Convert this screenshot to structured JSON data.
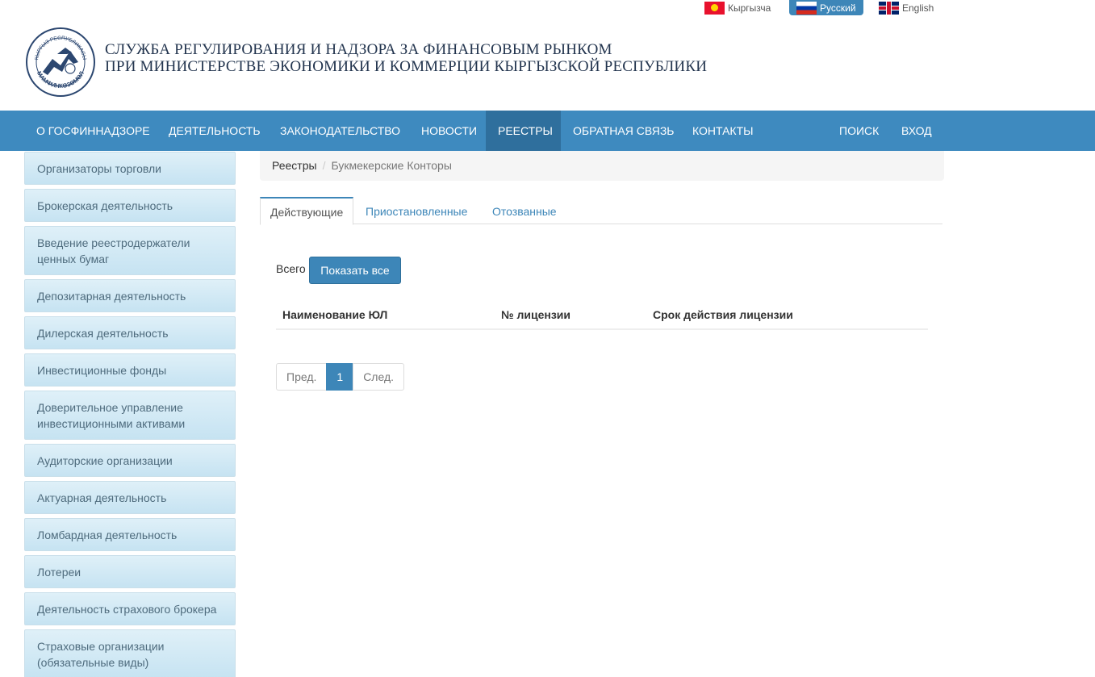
{
  "languages": [
    {
      "label": "Кыргызча"
    },
    {
      "label": "Русский"
    },
    {
      "label": "English"
    }
  ],
  "header": {
    "line1": "СЛУЖБА РЕГУЛИРОВАНИЯ И НАДЗОРА ЗА ФИНАНСОВЫМ РЫНКОМ",
    "line2": "ПРИ МИНИСТЕРСТВЕ ЭКОНОМИКИ И КОММЕРЦИИ КЫРГЫЗСКОЙ РЕСПУБЛИКИ",
    "logo_text_top": "КЫРГЫЗ РЕСПУБЛИКАСЫ",
    "logo_text_bottom": "МАМФИНКӨЗӨМӨЛ"
  },
  "nav": [
    {
      "label": "О ГОСФИННАДЗОРЕ"
    },
    {
      "label": "ДЕЯТЕЛЬНОСТЬ"
    },
    {
      "label": "ЗАКОНОДАТЕЛЬСТВО"
    },
    {
      "label": "НОВОСТИ"
    },
    {
      "label": "РЕЕСТРЫ"
    },
    {
      "label": "ОБРАТНАЯ СВЯЗЬ"
    },
    {
      "label": "КОНТАКТЫ"
    },
    {
      "label": "ПОИСК"
    },
    {
      "label": "ВХОД"
    }
  ],
  "sidebar": [
    {
      "label": "Организаторы торговли"
    },
    {
      "label": "Брокерская деятельность"
    },
    {
      "label": "Введение реестродержатели ценных бумаг"
    },
    {
      "label": "Депозитарная деятельность"
    },
    {
      "label": "Дилерская деятельность"
    },
    {
      "label": "Инвестиционные фонды"
    },
    {
      "label": "Доверительное управление инвестиционными активами"
    },
    {
      "label": "Аудиторские организации"
    },
    {
      "label": "Актуарная деятельность"
    },
    {
      "label": "Ломбардная деятельность"
    },
    {
      "label": "Лотереи"
    },
    {
      "label": "Деятельность страхового брокера"
    },
    {
      "label": "Страховые организации (обязательные виды)"
    }
  ],
  "breadcrumb": {
    "root": "Реестры",
    "separator": "/",
    "current": "Букмекерские Конторы"
  },
  "tabs": [
    {
      "label": "Действующие"
    },
    {
      "label": "Приостановленные"
    },
    {
      "label": "Отозванные"
    }
  ],
  "content": {
    "total_label": "Всего",
    "show_all_button": "Показать все",
    "columns": [
      "Наименование ЮЛ",
      "№ лицензии",
      "Срок действия лицензии"
    ]
  },
  "pagination": {
    "prev": "Пред.",
    "page": "1",
    "next": "След."
  },
  "colors": {
    "nav_bg": "#3e8abf",
    "nav_active": "#2f6f9d",
    "accent": "#3d86b8",
    "sidebar_bg": "#d4eaf5"
  }
}
